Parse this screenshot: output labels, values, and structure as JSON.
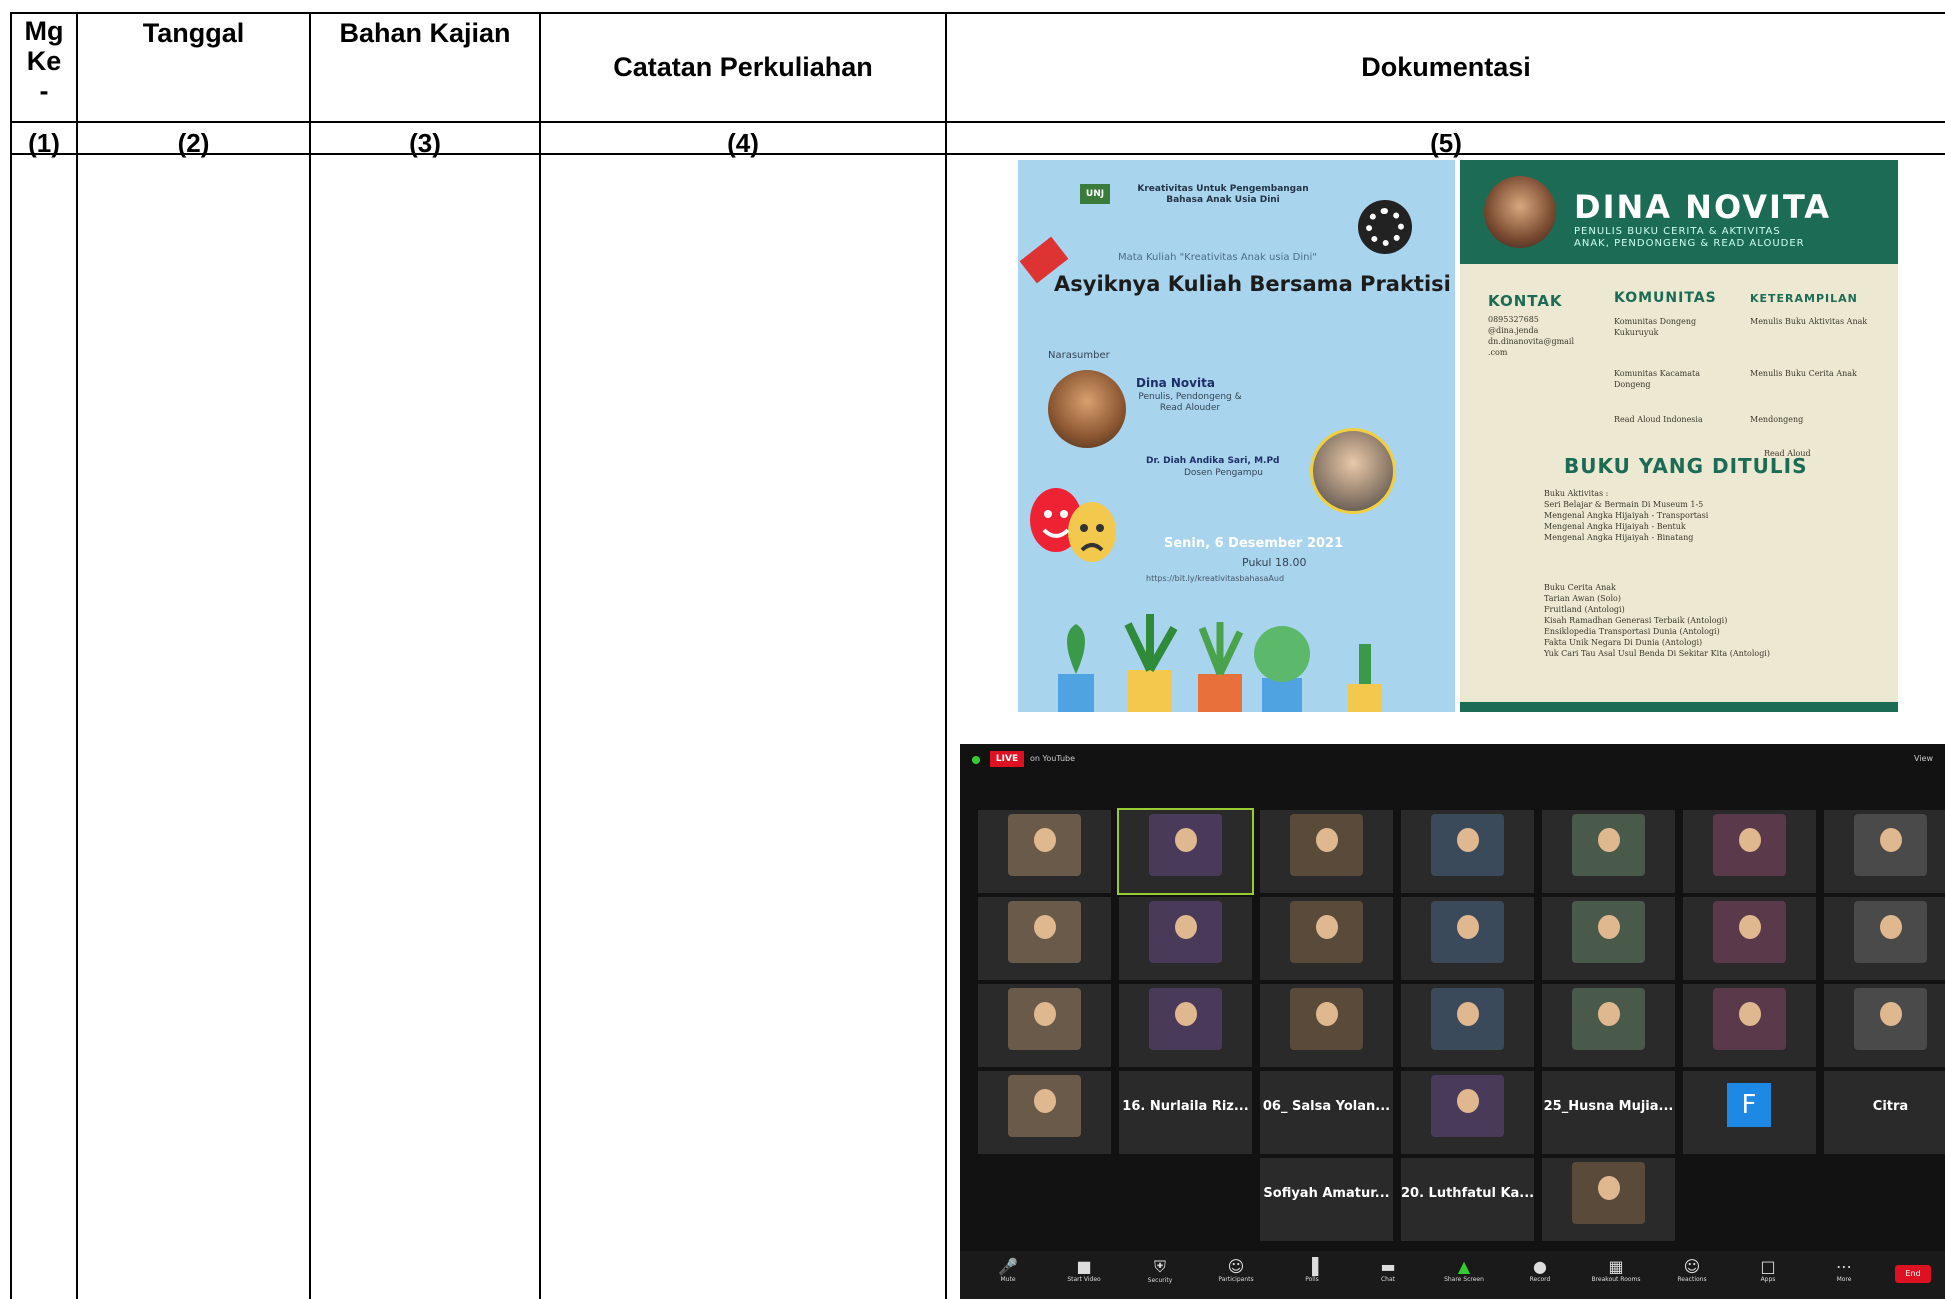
{
  "headers": {
    "col1": [
      "Mg",
      "Ke",
      "-"
    ],
    "col2": "Tanggal",
    "col3": "Bahan Kajian",
    "col4": "Catatan Perkuliahan",
    "col5": "Dokumentasi"
  },
  "numbers": [
    "(1)",
    "(2)",
    "(3)",
    "(4)",
    "(5)"
  ],
  "poster1": {
    "org": "Kreativitas Untuk Pengembangan Bahasa Anak Usia Dini",
    "course": "Mata Kuliah \"Kreativitas Anak usia Dini\"",
    "title": "Asyiknya Kuliah Bersama Praktisi",
    "narasumber": "Narasumber",
    "speaker1": "Dina Novita",
    "speaker1_desc": "Penulis, Pendongeng & Read Alouder",
    "speaker2": "Dr. Diah Andika Sari, M.Pd",
    "speaker2_desc": "Dosen Pengampu",
    "date": "Senin, 6 Desember 2021",
    "time": "Pukul 18.00",
    "link": "https://bit.ly/kreativitasbahasaAud"
  },
  "poster2": {
    "name": "DINA NOVITA",
    "role_line1": "PENULIS BUKU CERITA & AKTIVITAS",
    "role_line2": "ANAK, PENDONGENG & READ ALOUDER",
    "kontak_title": "KONTAK",
    "kontak": [
      "0895327685",
      "@dina.jenda",
      "dn.dinanovita@gmail",
      ".com"
    ],
    "komunitas_title": "KOMUNITAS",
    "komunitas": [
      "Komunitas Dongeng Kukuruyuk",
      "Komunitas Kacamata Dongeng",
      "Read Aloud Indonesia"
    ],
    "keterampilan_title": "KETERAMPILAN",
    "keterampilan": [
      "Menulis Buku Aktivitas Anak",
      "Menulis Buku Cerita Anak",
      "Mendongeng",
      "Read Aloud"
    ],
    "buku_title": "BUKU YANG DITULIS",
    "buku_aktivitas_title": "Buku Aktivitas :",
    "buku_aktivitas": [
      "Seri Belajar & Bermain Di Museum 1-5",
      "Mengenal Angka Hijaiyah - Transportasi",
      "Mengenal Angka Hijaiyah - Bentuk",
      "Mengenal Angka Hijaiyah - Binatang"
    ],
    "buku_cerita_title": "Buku Cerita Anak",
    "buku_cerita": [
      "Tarian Awan (Solo)",
      "Fruitland (Antologi)",
      "Kisah Ramadhan Generasi Terbaik (Antologi)",
      "Ensiklopedia Transportasi Dunia (Antologi)",
      "Fakta Unik Negara Di Dunia (Antologi)",
      "Yuk Cari Tau Asal Usul Benda Di Sekitar Kita (Antologi)"
    ]
  },
  "zoom": {
    "live": "LIVE",
    "youtube": "on YouTube",
    "view": "View",
    "name_tiles": [
      "16. Nurlaila Riz...",
      "06_ Salsa Yolan...",
      "25_Husna Mujia...",
      "Citra",
      "Sofiyah Amatur...",
      "20. Luthfatul Ka..."
    ],
    "f_letter": "F",
    "toolbar": [
      "Mute",
      "Start Video",
      "Security",
      "Participants",
      "Polls",
      "Chat",
      "Share Screen",
      "Record",
      "Breakout Rooms",
      "Reactions",
      "Apps",
      "More"
    ],
    "end": "End"
  }
}
